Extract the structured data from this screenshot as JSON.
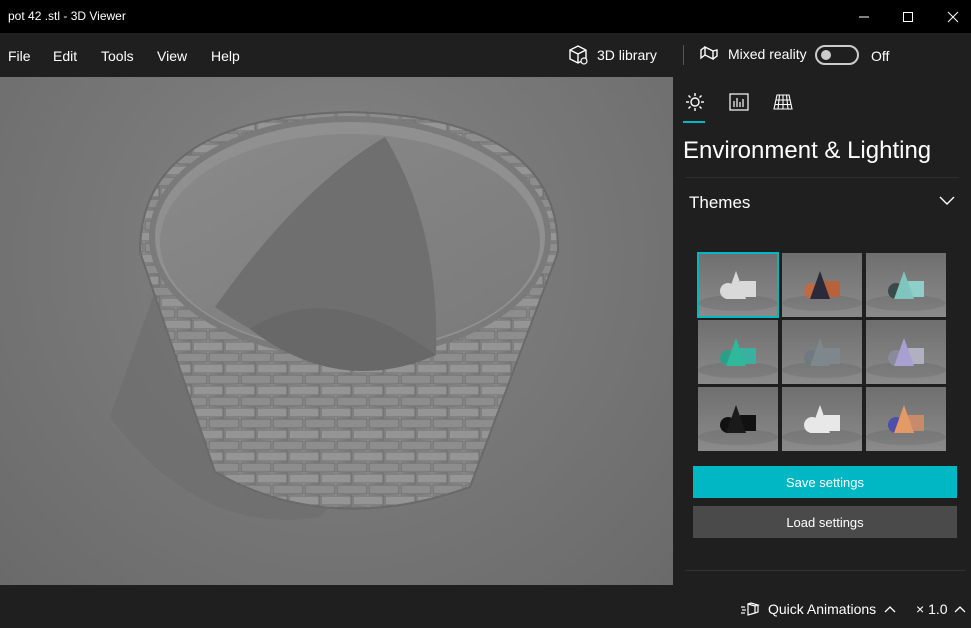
{
  "window": {
    "title": "pot 42 .stl - 3D Viewer"
  },
  "menu": {
    "items": [
      "File",
      "Edit",
      "Tools",
      "View",
      "Help"
    ]
  },
  "toolbar": {
    "library_label": "3D library",
    "mixed_reality_label": "Mixed reality",
    "mixed_reality_state": "Off"
  },
  "panel": {
    "tabs": [
      "environment-lighting-tab",
      "stats-shading-tab",
      "grid-views-tab"
    ],
    "title": "Environment & Lighting",
    "themes_label": "Themes",
    "themes": [
      {
        "name": "default-gray",
        "colors": [
          "#d9d9d9",
          "#d9d9d9",
          "#d9d9d9"
        ],
        "selected": true
      },
      {
        "name": "sunset",
        "colors": [
          "#c06a45",
          "#2a2a3a",
          "#b8623c"
        ]
      },
      {
        "name": "teal-soft",
        "colors": [
          "#3a4a4a",
          "#7fc4bd",
          "#8fcfc9"
        ]
      },
      {
        "name": "emerald",
        "colors": [
          "#2f9e88",
          "#2fb89a",
          "#3ab0a0"
        ]
      },
      {
        "name": "slate",
        "colors": [
          "#6f7a80",
          "#7d878c",
          "#7d878c"
        ]
      },
      {
        "name": "lavender",
        "colors": [
          "#8a8a9a",
          "#a7a0d0",
          "#b0b0c0"
        ]
      },
      {
        "name": "dark",
        "colors": [
          "#111111",
          "#1a1a1a",
          "#111111"
        ]
      },
      {
        "name": "white",
        "colors": [
          "#e8e8e8",
          "#e8e8e8",
          "#e8e8e8"
        ]
      },
      {
        "name": "dusk",
        "colors": [
          "#4d4fa8",
          "#e39a66",
          "#c78a6a"
        ]
      }
    ],
    "save_label": "Save settings",
    "load_label": "Load settings"
  },
  "status": {
    "animations_label": "Quick Animations",
    "zoom_label": "× 1.0"
  },
  "colors": {
    "accent": "#00b7c3",
    "bg": "#1f1f1f",
    "titlebar": "#000000"
  }
}
